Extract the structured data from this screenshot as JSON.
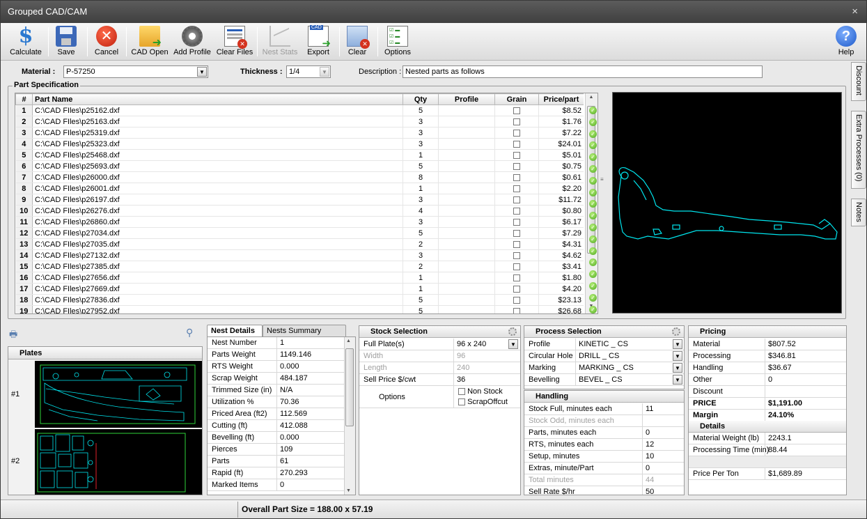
{
  "window": {
    "title": "Grouped CAD/CAM",
    "close_glyph": "×"
  },
  "toolbar": {
    "buttons": [
      {
        "label": "Calculate",
        "icon": "dollar-icon"
      },
      {
        "label": "Save",
        "icon": "floppy-icon"
      },
      {
        "label": "Cancel",
        "icon": "cancel-icon"
      },
      {
        "label": "CAD Open",
        "icon": "folder-open-icon"
      },
      {
        "label": "Add Profile",
        "icon": "gear-icon"
      },
      {
        "label": "Clear Files",
        "icon": "clear-files-icon"
      },
      {
        "label": "Nest Stats",
        "icon": "chart-icon"
      },
      {
        "label": "Export",
        "icon": "export-icon"
      },
      {
        "label": "Clear",
        "icon": "clear-icon"
      },
      {
        "label": "Options",
        "icon": "checklist-icon"
      },
      {
        "label": "Help",
        "icon": "help-icon"
      }
    ],
    "help_glyph": "?",
    "cancel_glyph": "✕",
    "dollar_glyph": "$"
  },
  "fields": {
    "material_label": "Material :",
    "material_value": "P-57250",
    "thickness_label": "Thickness :",
    "thickness_value": "1/4",
    "description_label": "Description :",
    "description_value": "Nested parts as follows"
  },
  "part_spec": {
    "title": "Part Specification",
    "columns": [
      "#",
      "Part Name",
      "Qty",
      "Profile",
      "Grain",
      "Price/part"
    ],
    "rows": [
      {
        "n": "1",
        "name": "C:\\CAD FIles\\p25162.dxf",
        "qty": "5",
        "price": "$8.52"
      },
      {
        "n": "2",
        "name": "C:\\CAD FIles\\p25163.dxf",
        "qty": "3",
        "price": "$1.76"
      },
      {
        "n": "3",
        "name": "C:\\CAD FIles\\p25319.dxf",
        "qty": "3",
        "price": "$7.22"
      },
      {
        "n": "4",
        "name": "C:\\CAD FIles\\p25323.dxf",
        "qty": "3",
        "price": "$24.01"
      },
      {
        "n": "5",
        "name": "C:\\CAD FIles\\p25468.dxf",
        "qty": "1",
        "price": "$5.01"
      },
      {
        "n": "6",
        "name": "C:\\CAD FIles\\p25693.dxf",
        "qty": "5",
        "price": "$0.75"
      },
      {
        "n": "7",
        "name": "C:\\CAD FIles\\p26000.dxf",
        "qty": "8",
        "price": "$0.61"
      },
      {
        "n": "8",
        "name": "C:\\CAD FIles\\p26001.dxf",
        "qty": "1",
        "price": "$2.20"
      },
      {
        "n": "9",
        "name": "C:\\CAD FIles\\p26197.dxf",
        "qty": "3",
        "price": "$11.72"
      },
      {
        "n": "10",
        "name": "C:\\CAD FIles\\p26276.dxf",
        "qty": "4",
        "price": "$0.80"
      },
      {
        "n": "11",
        "name": "C:\\CAD FIles\\p26860.dxf",
        "qty": "3",
        "price": "$6.17"
      },
      {
        "n": "12",
        "name": "C:\\CAD FIles\\p27034.dxf",
        "qty": "5",
        "price": "$7.29"
      },
      {
        "n": "13",
        "name": "C:\\CAD FIles\\p27035.dxf",
        "qty": "2",
        "price": "$4.31"
      },
      {
        "n": "14",
        "name": "C:\\CAD FIles\\p27132.dxf",
        "qty": "3",
        "price": "$4.62"
      },
      {
        "n": "15",
        "name": "C:\\CAD FIles\\p27385.dxf",
        "qty": "2",
        "price": "$3.41"
      },
      {
        "n": "16",
        "name": "C:\\CAD FIles\\p27656.dxf",
        "qty": "1",
        "price": "$1.80"
      },
      {
        "n": "17",
        "name": "C:\\CAD FIles\\p27669.dxf",
        "qty": "1",
        "price": "$4.20"
      },
      {
        "n": "18",
        "name": "C:\\CAD FIles\\p27836.dxf",
        "qty": "5",
        "price": "$23.13"
      },
      {
        "n": "19",
        "name": "C:\\CAD FIles\\p27952.dxf",
        "qty": "5",
        "price": "$26.68"
      }
    ]
  },
  "side_tabs": [
    "Discount",
    "Extra Processes (0)",
    "Notes"
  ],
  "plates": {
    "title": "Plates",
    "items": [
      {
        "label": "#1"
      },
      {
        "label": "#2"
      }
    ]
  },
  "nest_tabs": [
    "Nest Details",
    "Nests Summary Details"
  ],
  "nest_details": [
    {
      "k": "Nest Number",
      "v": "1"
    },
    {
      "k": "Parts Weight",
      "v": "1149.146"
    },
    {
      "k": "RTS Weight",
      "v": "0.000"
    },
    {
      "k": "Scrap Weight",
      "v": "484.187"
    },
    {
      "k": "Trimmed Size (in)",
      "v": "N/A"
    },
    {
      "k": "Utilization %",
      "v": "70.36"
    },
    {
      "k": "Priced Area (ft2)",
      "v": "112.569"
    },
    {
      "k": "Cutting (ft)",
      "v": "412.088"
    },
    {
      "k": "Bevelling (ft)",
      "v": "0.000"
    },
    {
      "k": "Pierces",
      "v": "109"
    },
    {
      "k": "Parts",
      "v": "61"
    },
    {
      "k": "Rapid (ft)",
      "v": "270.293"
    },
    {
      "k": "Marked Items",
      "v": "0"
    }
  ],
  "stock": {
    "title": "Stock Selection",
    "rows": [
      {
        "k": "Full Plate(s)",
        "v": "96 x 240",
        "gray": false
      },
      {
        "k": "Width",
        "v": "96",
        "gray": true
      },
      {
        "k": "Length",
        "v": "240",
        "gray": true
      },
      {
        "k": "Sell Price $/cwt",
        "v": "36",
        "gray": false
      }
    ],
    "options_label": "Options",
    "opt1": "Non Stock",
    "opt2": "ScrapOffcut"
  },
  "process": {
    "title": "Process Selection",
    "rows": [
      {
        "k": "Profile",
        "v": "KINETIC _ CS"
      },
      {
        "k": "Circular Hole",
        "v": "DRILL _ CS"
      },
      {
        "k": "Marking",
        "v": "MARKING _ CS"
      },
      {
        "k": "Bevelling",
        "v": "BEVEL _ CS"
      }
    ]
  },
  "handling": {
    "title": "Handling",
    "rows": [
      {
        "k": "Stock Full, minutes each",
        "v": "11",
        "gray": false
      },
      {
        "k": "Stock Odd, minutes each",
        "v": "",
        "gray": true
      },
      {
        "k": "Parts, minutes each",
        "v": "0",
        "gray": false
      },
      {
        "k": "RTS, minutes each",
        "v": "12",
        "gray": false
      },
      {
        "k": "Setup, minutes",
        "v": "10",
        "gray": false
      },
      {
        "k": "Extras, minute/Part",
        "v": "0",
        "gray": false
      },
      {
        "k": "Total minutes",
        "v": "44",
        "gray": true
      },
      {
        "k": "Sell Rate $/hr",
        "v": "50",
        "gray": false
      }
    ]
  },
  "pricing": {
    "title": "Pricing",
    "rows": [
      {
        "k": "Material",
        "v": "$807.52",
        "bold": false
      },
      {
        "k": "Processing",
        "v": "$346.81",
        "bold": false
      },
      {
        "k": "Handling",
        "v": "$36.67",
        "bold": false
      },
      {
        "k": "Other",
        "v": "0",
        "bold": false
      },
      {
        "k": "Discount",
        "v": "",
        "bold": false
      },
      {
        "k": "PRICE",
        "v": "$1,191.00",
        "bold": true
      },
      {
        "k": "Margin",
        "v": "24.10%",
        "bold": true
      }
    ],
    "details_title": "Details",
    "details": [
      {
        "k": "Material Weight (lb)",
        "v": "2243.1"
      },
      {
        "k": "Processing Time (min)",
        "v": "88.44"
      }
    ],
    "price_per_ton_label": "Price Per Ton",
    "price_per_ton_value": "$1,689.89"
  },
  "status": {
    "overall_part_size": "Overall Part Size = 188.00 x 57.19"
  },
  "colors": {
    "cad_line": "#00e5ee",
    "accent_green": "#4ca61e",
    "plate_outline": "#2fd33a"
  }
}
